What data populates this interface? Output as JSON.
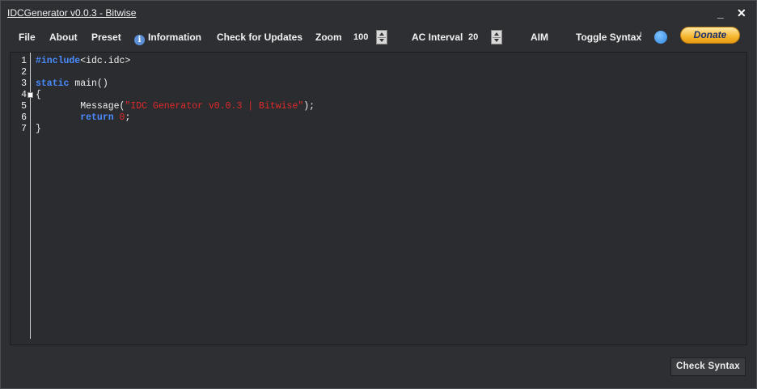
{
  "window": {
    "title": "IDCGenerator v0.0.3 - Bitwise",
    "minimize": "_",
    "close": "✕"
  },
  "toolbar": {
    "file": "File",
    "about": "About",
    "preset": "Preset",
    "information": "Information",
    "check_updates": "Check for Updates",
    "zoom_label": "Zoom",
    "zoom_value": "100",
    "ac_interval_label": "AC Interval",
    "ac_interval_value": "20",
    "aim": "AIM",
    "toggle_syntax_label": "Toggle Syntax",
    "toggle_tick": "!",
    "donate": "Donate"
  },
  "editor": {
    "line_numbers": [
      "1",
      "2",
      "3",
      "4",
      "5",
      "6",
      "7"
    ],
    "lines": [
      [
        {
          "t": "#include",
          "c": "kw"
        },
        {
          "t": "<idc.idc>",
          "c": ""
        }
      ],
      [],
      [
        {
          "t": "static",
          "c": "kw"
        },
        {
          "t": " main()",
          "c": ""
        }
      ],
      [
        {
          "t": "{",
          "c": ""
        }
      ],
      [
        {
          "t": "        Message(",
          "c": ""
        },
        {
          "t": "\"IDC Generator v0.0.3 | Bitwise\"",
          "c": "str"
        },
        {
          "t": ");",
          "c": ""
        }
      ],
      [
        {
          "t": "        ",
          "c": ""
        },
        {
          "t": "return",
          "c": "kw"
        },
        {
          "t": " ",
          "c": ""
        },
        {
          "t": "0",
          "c": "str"
        },
        {
          "t": ";",
          "c": ""
        }
      ],
      [
        {
          "t": "}",
          "c": ""
        }
      ]
    ]
  },
  "footer": {
    "check_syntax": "Check Syntax"
  },
  "colors": {
    "accent": "#4a8cff",
    "string": "#e22a2a",
    "background": "#2d2f33"
  }
}
